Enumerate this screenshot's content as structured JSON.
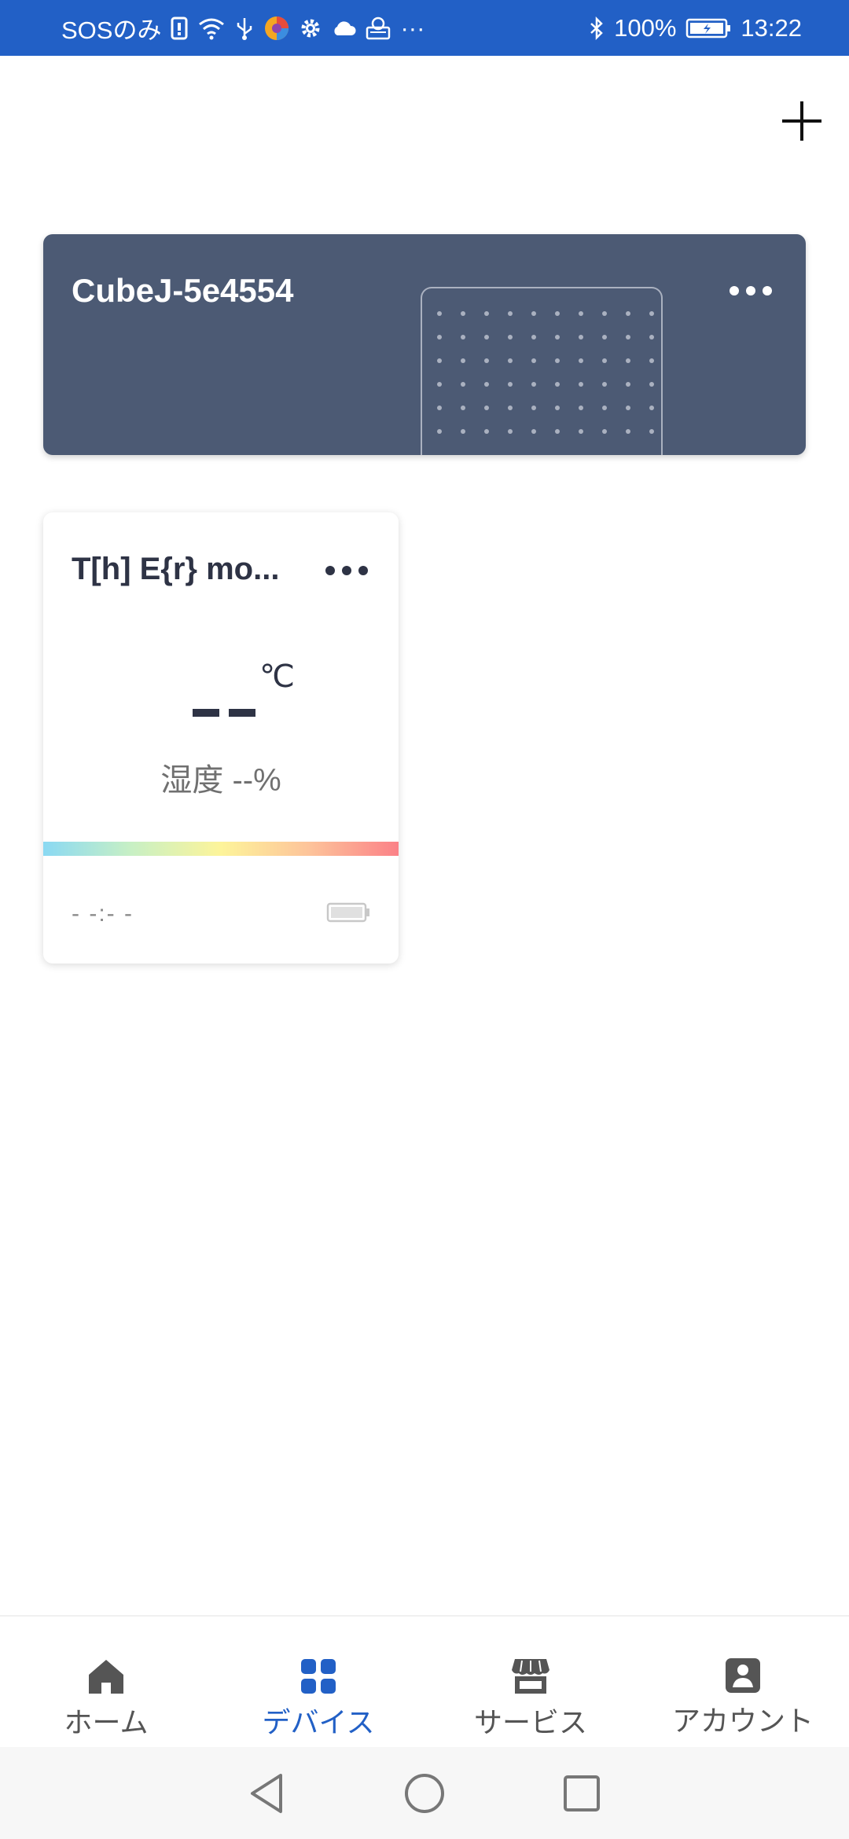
{
  "status_bar": {
    "carrier": "SOSのみ",
    "ellipsis": "···",
    "battery_percent": "100%",
    "time": "13:22",
    "background": "#2260c6"
  },
  "header": {
    "add_icon": "plus-icon"
  },
  "gateway": {
    "name": "CubeJ-5e4554",
    "more_icon": "more-horizontal-icon",
    "card_color": "#4c5a74"
  },
  "sensor": {
    "name": "T[h] E{r} mo...",
    "temperature_value": "--",
    "temperature_unit": "℃",
    "humidity_text": "湿度 --%",
    "last_update": "- -:- -",
    "battery_icon": "battery-icon"
  },
  "bottom_nav": {
    "items": [
      {
        "label": "ホーム",
        "icon": "home-icon",
        "active": false
      },
      {
        "label": "デバイス",
        "icon": "grid-icon",
        "active": true
      },
      {
        "label": "サービス",
        "icon": "store-icon",
        "active": false
      },
      {
        "label": "アカウント",
        "icon": "account-icon",
        "active": false
      }
    ],
    "active_color": "#2260c6"
  },
  "system_nav": {
    "back_icon": "back-triangle-icon",
    "home_icon": "home-circle-icon",
    "recents_icon": "recents-square-icon"
  }
}
